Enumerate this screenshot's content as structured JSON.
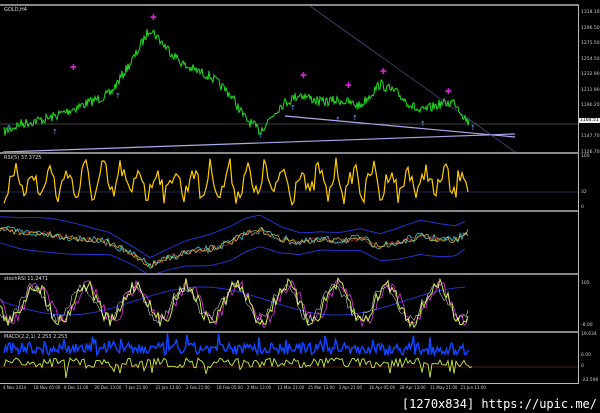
{
  "symbol_label": "GOLD,H4",
  "price_axis": [
    "1318.10",
    "1296.50",
    "1275.50",
    "1254.50",
    "1232.90",
    "1211.90",
    "1190.20",
    "1169.30",
    "1147.70",
    "1126.70"
  ],
  "current_price": "1164.51",
  "rsi": {
    "label": "RSI(5) 37.3725",
    "axis": [
      "100",
      "32",
      "0"
    ],
    "level": "32"
  },
  "bands": {
    "label": "",
    "axis": []
  },
  "stochrsi": {
    "label": "stochRSI 11,2471",
    "axis": [
      "105",
      "-8.00"
    ]
  },
  "macd": {
    "label": "MACD(2,2,1) 2.253 2.253",
    "axis": [
      "19.634",
      "6.00",
      "0",
      "-23.596"
    ]
  },
  "time_axis": [
    "4 Nov 2014",
    "18 Nov 05:00",
    "8 Dec 21:00",
    "26 Dec 13:00",
    "7 Jan 21:00",
    "21 Jan 13:00",
    "2 Feb 21:00",
    "18 Feb 05:00",
    "2 Mar 13:00",
    "13 Mar 21:00",
    "25 Mar 13:00",
    "3 Apr 21:00",
    "16 Apr 05:00",
    "28 Apr 13:00",
    "11 May 21:00",
    "21 Jun 13:00"
  ],
  "watermark": "[1270x834] https://upic.me/",
  "colors": {
    "price": "#22dd22",
    "rsi": "#ffcc00",
    "macd": "#1144ff",
    "signal": "#ccee44",
    "arrow_up": "#44aaff",
    "arrow_down": "#dd22dd",
    "trendline": "#aaaaee"
  }
}
